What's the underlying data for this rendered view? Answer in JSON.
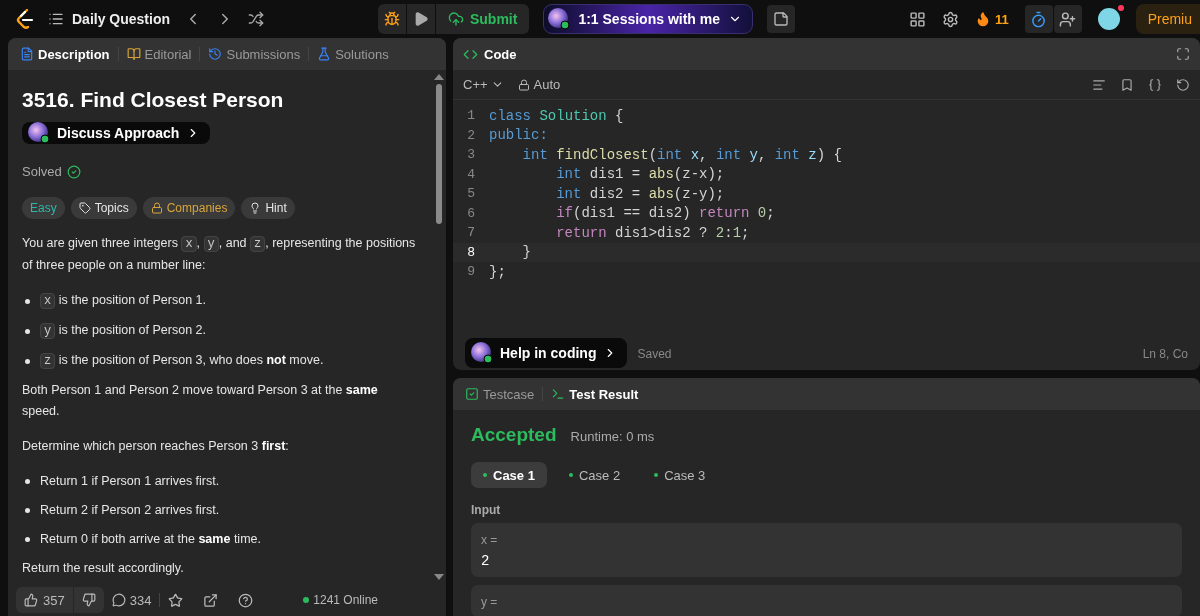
{
  "top_bar": {
    "title": "Daily Question",
    "submit": "Submit",
    "sessions": "1:1 Sessions with me",
    "streak": "11",
    "premium": "Premiu"
  },
  "problem_tabs": [
    {
      "label": "Description",
      "selected": true
    },
    {
      "label": "Editorial",
      "selected": false
    },
    {
      "label": "Submissions",
      "selected": false
    },
    {
      "label": "Solutions",
      "selected": false
    }
  ],
  "problem": {
    "title": "3516. Find Closest Person",
    "discuss": "Discuss Approach",
    "status": "Solved",
    "tags": [
      {
        "label": "Easy",
        "kind": "difficulty",
        "color": "#2db7a6"
      },
      {
        "label": "Topics",
        "kind": "topics",
        "color": "#e6e6e6"
      },
      {
        "label": "Companies",
        "kind": "companies",
        "color": "#d9a53a"
      },
      {
        "label": "Hint",
        "kind": "hint",
        "color": "#e6e6e6"
      }
    ],
    "blocks": [
      {
        "kind": "paragraph",
        "parts": [
          {
            "kind": "text",
            "text": "You are given three integers "
          },
          {
            "kind": "code",
            "text": "x"
          },
          {
            "kind": "text",
            "text": ", "
          },
          {
            "kind": "code",
            "text": "y"
          },
          {
            "kind": "text",
            "text": ", and "
          },
          {
            "kind": "code",
            "text": "z"
          },
          {
            "kind": "text",
            "text": ", representing the positions of three people on a number line:"
          }
        ]
      },
      {
        "kind": "bullet",
        "parts": [
          {
            "kind": "code",
            "text": "x"
          },
          {
            "kind": "text",
            "text": " is the position of Person 1."
          }
        ]
      },
      {
        "kind": "bullet",
        "parts": [
          {
            "kind": "code",
            "text": "y"
          },
          {
            "kind": "text",
            "text": " is the position of Person 2."
          }
        ]
      },
      {
        "kind": "bullet",
        "parts": [
          {
            "kind": "code",
            "text": "z"
          },
          {
            "kind": "text",
            "text": " is the position of Person 3, who does **not** move."
          }
        ]
      },
      {
        "kind": "paragraph",
        "parts": [
          {
            "kind": "text",
            "text": "Both Person 1 and Person 2 move toward Person 3 at the **same** speed."
          }
        ]
      },
      {
        "kind": "paragraph",
        "parts": [
          {
            "kind": "text",
            "text": "Determine which person reaches Person 3 **first**:"
          }
        ]
      },
      {
        "kind": "bullet",
        "parts": [
          {
            "kind": "text",
            "text": "Return 1 if Person 1 arrives first."
          }
        ]
      },
      {
        "kind": "bullet",
        "parts": [
          {
            "kind": "text",
            "text": "Return 2 if Person 2 arrives first."
          }
        ]
      },
      {
        "kind": "bullet",
        "parts": [
          {
            "kind": "text",
            "text": "Return 0 if both arrive at the **same** time."
          }
        ]
      },
      {
        "kind": "paragraph",
        "parts": [
          {
            "kind": "text",
            "text": "Return the result accordingly."
          }
        ]
      }
    ],
    "likes": "357",
    "comments": "334",
    "online": "1241 Online"
  },
  "code_panel": {
    "title": "Code",
    "language": "C++",
    "mode": "Auto",
    "help": "Help in coding",
    "saved": "Saved",
    "cursor": "Ln 8, Co",
    "lines": [
      {
        "number": "1",
        "selected": false,
        "tokens": [
          {
            "kind": "keyword",
            "text": "class "
          },
          {
            "kind": "type",
            "text": "Solution"
          },
          {
            "kind": "plain",
            "text": " {"
          }
        ]
      },
      {
        "number": "2",
        "selected": false,
        "tokens": [
          {
            "kind": "keyword",
            "text": "public:"
          }
        ]
      },
      {
        "number": "3",
        "selected": false,
        "tokens": [
          {
            "kind": "keyword",
            "text": "    int "
          },
          {
            "kind": "function",
            "text": "findClosest"
          },
          {
            "kind": "plain",
            "text": "("
          },
          {
            "kind": "keyword",
            "text": "int "
          },
          {
            "kind": "variable",
            "text": "x"
          },
          {
            "kind": "plain",
            "text": ", "
          },
          {
            "kind": "keyword",
            "text": "int "
          },
          {
            "kind": "variable",
            "text": "y"
          },
          {
            "kind": "plain",
            "text": ", "
          },
          {
            "kind": "keyword",
            "text": "int "
          },
          {
            "kind": "variable",
            "text": "z"
          },
          {
            "kind": "plain",
            "text": ") {"
          }
        ]
      },
      {
        "number": "4",
        "selected": false,
        "tokens": [
          {
            "kind": "keyword",
            "text": "        int "
          },
          {
            "kind": "plain",
            "text": "dis1 = "
          },
          {
            "kind": "function",
            "text": "abs"
          },
          {
            "kind": "plain",
            "text": "(z-x);"
          }
        ]
      },
      {
        "number": "5",
        "selected": false,
        "tokens": [
          {
            "kind": "keyword",
            "text": "        int "
          },
          {
            "kind": "plain",
            "text": "dis2 = "
          },
          {
            "kind": "function",
            "text": "abs"
          },
          {
            "kind": "plain",
            "text": "(z-y);"
          }
        ]
      },
      {
        "number": "6",
        "selected": false,
        "tokens": [
          {
            "kind": "control",
            "text": "        if"
          },
          {
            "kind": "plain",
            "text": "(dis1 == dis2) "
          },
          {
            "kind": "control",
            "text": "return "
          },
          {
            "kind": "number",
            "text": "0"
          },
          {
            "kind": "plain",
            "text": ";"
          }
        ]
      },
      {
        "number": "7",
        "selected": false,
        "tokens": [
          {
            "kind": "control",
            "text": "        return "
          },
          {
            "kind": "plain",
            "text": "dis1>dis2 ? "
          },
          {
            "kind": "number",
            "text": "2"
          },
          {
            "kind": "plain",
            "text": ":"
          },
          {
            "kind": "number",
            "text": "1"
          },
          {
            "kind": "plain",
            "text": ";"
          }
        ]
      },
      {
        "number": "8",
        "selected": true,
        "tokens": [
          {
            "kind": "plain",
            "text": "    }"
          }
        ]
      },
      {
        "number": "9",
        "selected": false,
        "tokens": [
          {
            "kind": "plain",
            "text": "};"
          }
        ]
      }
    ]
  },
  "result_tabs": [
    {
      "label": "Testcase",
      "selected": false
    },
    {
      "label": "Test Result",
      "selected": true
    }
  ],
  "result": {
    "verdict": "Accepted",
    "runtime": "Runtime: 0 ms",
    "cases": [
      {
        "label": "Case 1",
        "selected": true
      },
      {
        "label": "Case 2",
        "selected": false
      },
      {
        "label": "Case 3",
        "selected": false
      }
    ],
    "input_label": "Input",
    "inputs": [
      {
        "name": "x =",
        "value": "2"
      },
      {
        "name": "y ="
      }
    ]
  }
}
